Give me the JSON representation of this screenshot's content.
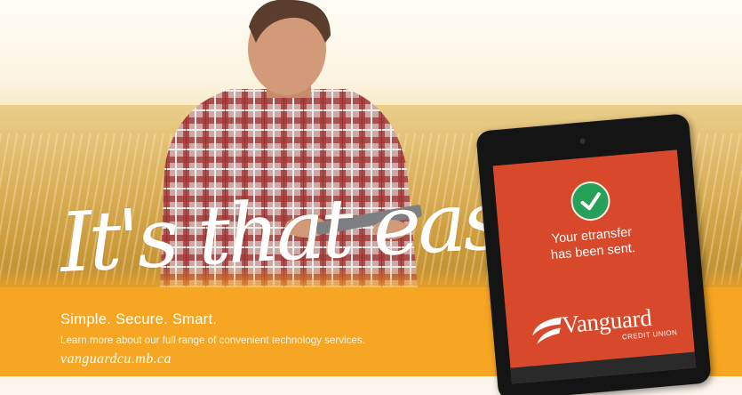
{
  "headline": "It's that easy!",
  "tagline": "Simple. Secure. Smart.",
  "description": "Learn more about our full range of convenient technology services.",
  "website": "vanguardcu.mb.ca",
  "tablet": {
    "message_line1": "Your etransfer",
    "message_line2": "has been sent.",
    "icon": "checkmark-icon",
    "brand_name": "Vanguard",
    "brand_sub": "CREDIT UNION"
  },
  "colors": {
    "band": "#f6a623",
    "screen": "#d8482a",
    "check": "#27a05a"
  }
}
